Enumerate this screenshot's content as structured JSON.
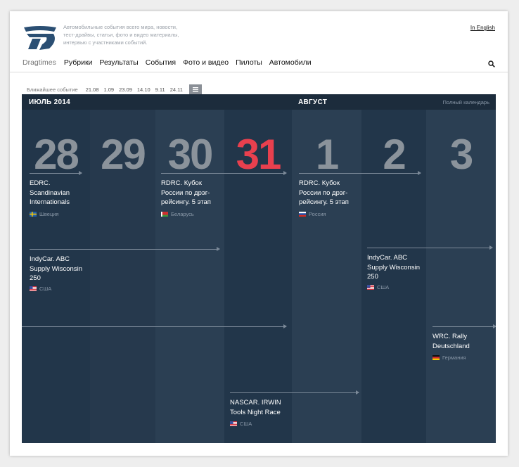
{
  "header": {
    "tagline": "Автомобильные события всего мира, новости, тест-драйвы, статьи, фото и видео материалы, интервью с участниками событий.",
    "lang_link": "In English"
  },
  "nav": {
    "brand": "Dragtimes",
    "items": [
      "Рубрики",
      "Результаты",
      "События",
      "Фото и видео",
      "Пилоты",
      "Автомобили"
    ]
  },
  "upcoming": {
    "label": "Ближайшее событие",
    "dates": [
      "21.08",
      "1.09",
      "23.09",
      "14.10",
      "9.11",
      "24.11"
    ]
  },
  "calendar": {
    "month_left": "ИЮЛЬ 2014",
    "month_right": "АВГУСТ",
    "full_calendar": "Полный календарь",
    "days": [
      "28",
      "29",
      "30",
      "31",
      "1",
      "2",
      "3"
    ],
    "today_index": 3,
    "events": [
      {
        "title": "EDRC. Scandinavian Internationals",
        "country": "Швеция",
        "flag": "sweden"
      },
      {
        "title": "RDRC. Кубок России по дрэг-рейсингу. 5 этап",
        "country": "Беларусь",
        "flag": "belarus"
      },
      {
        "title": "RDRC. Кубок России по дрэг-рейсингу. 5 этап",
        "country": "Россия",
        "flag": "russia"
      },
      {
        "title": "IndyCar. ABC Supply Wisconsin 250",
        "country": "США",
        "flag": "usa"
      },
      {
        "title": "IndyCar. ABC Supply Wisconsin 250",
        "country": "США",
        "flag": "usa"
      },
      {
        "title": "WRC. Rally Deutschland",
        "country": "Германия",
        "flag": "germany"
      },
      {
        "title": "NASCAR. IRWIN Tools Night Race",
        "country": "США",
        "flag": "usa"
      }
    ]
  },
  "colors": {
    "calendar_bg": "#22364a",
    "calendar_header": "#1c2c3c",
    "today_accent": "#e8404e",
    "day_number": "#8b939b"
  }
}
